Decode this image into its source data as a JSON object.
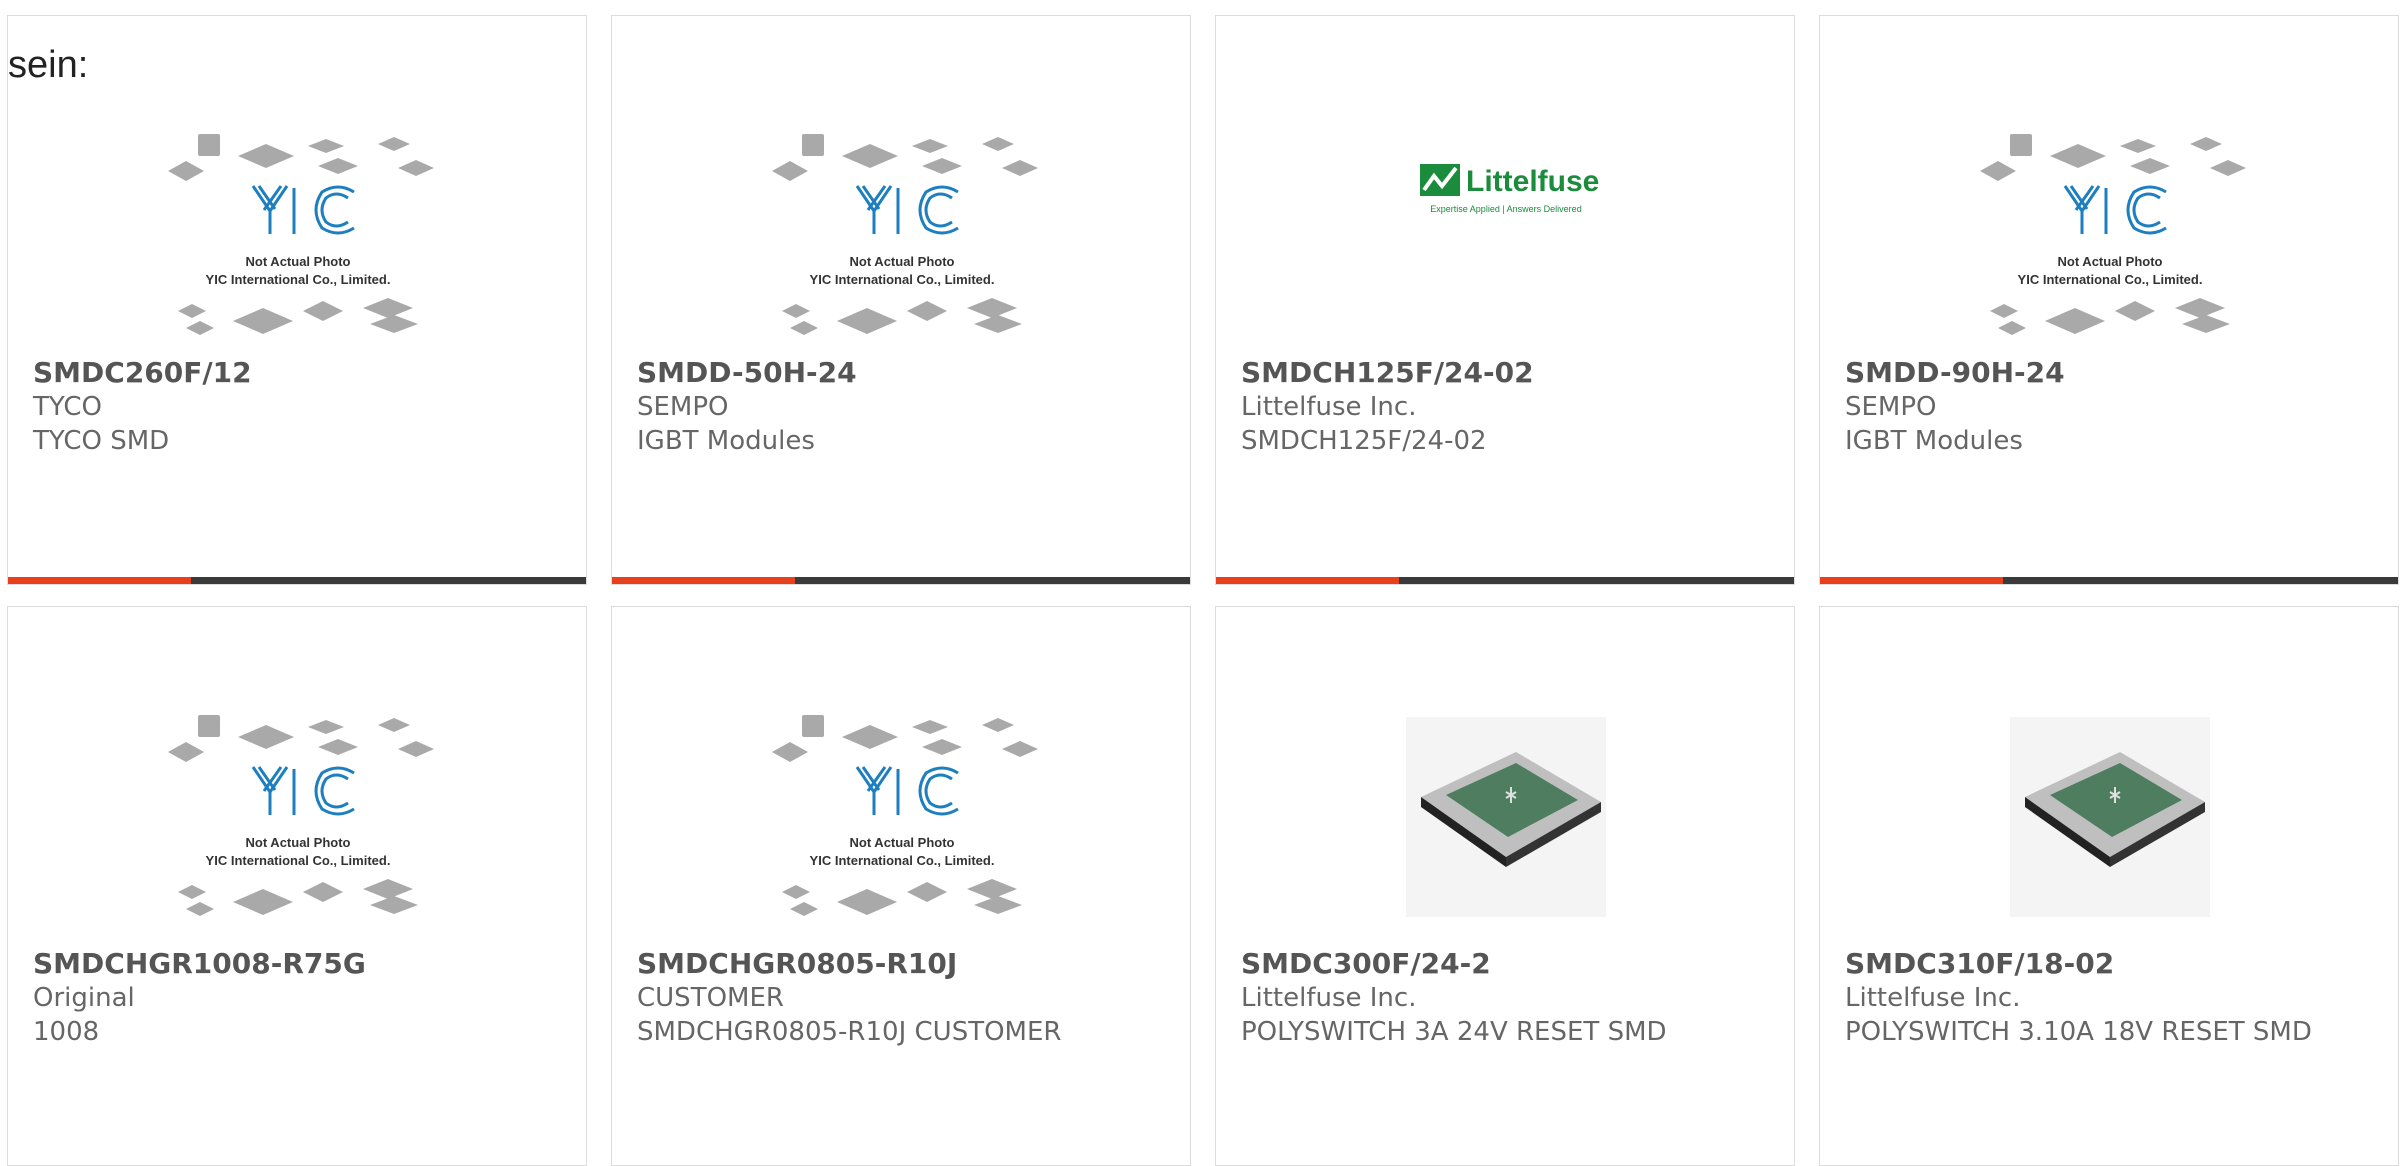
{
  "lead_text": "sein:",
  "colors": {
    "accent": "#e8401c",
    "bar": "#3a3a3a",
    "yic_blue": "#1e7fc0",
    "littelfuse_green": "#1a8c3c"
  },
  "placeholder": {
    "line1": "Not Actual Photo",
    "line2": "YIC International Co., Limited."
  },
  "littelfuse_logo": {
    "wordmark": "Littelfuse",
    "tagline": "Expertise Applied | Answers Delivered"
  },
  "products": [
    {
      "part_number": "SMDC260F/12",
      "manufacturer": "TYCO",
      "description": "TYCO SMD",
      "image": "yic-placeholder"
    },
    {
      "part_number": "SMDD-50H-24",
      "manufacturer": "SEMPO",
      "description": "IGBT Modules",
      "image": "yic-placeholder"
    },
    {
      "part_number": "SMDCH125F/24-02",
      "manufacturer": "Littelfuse Inc.",
      "description": "SMDCH125F/24-02",
      "image": "littelfuse-logo"
    },
    {
      "part_number": "SMDD-90H-24",
      "manufacturer": "SEMPO",
      "description": "IGBT Modules",
      "image": "yic-placeholder"
    },
    {
      "part_number": "SMDCHGR1008-R75G",
      "manufacturer": "Original",
      "description": "1008",
      "image": "yic-placeholder"
    },
    {
      "part_number": "SMDCHGR0805-R10J",
      "manufacturer": "CUSTOMER",
      "description": "SMDCHGR0805-R10J CUSTOMER",
      "image": "yic-placeholder"
    },
    {
      "part_number": "SMDC300F/24-2",
      "manufacturer": "Littelfuse Inc.",
      "description": "POLYSWITCH 3A 24V RESET SMD",
      "image": "smd-fuse-photo"
    },
    {
      "part_number": "SMDC310F/18-02",
      "manufacturer": "Littelfuse Inc.",
      "description": "POLYSWITCH 3.10A 18V RESET SMD",
      "image": "smd-fuse-photo"
    }
  ]
}
